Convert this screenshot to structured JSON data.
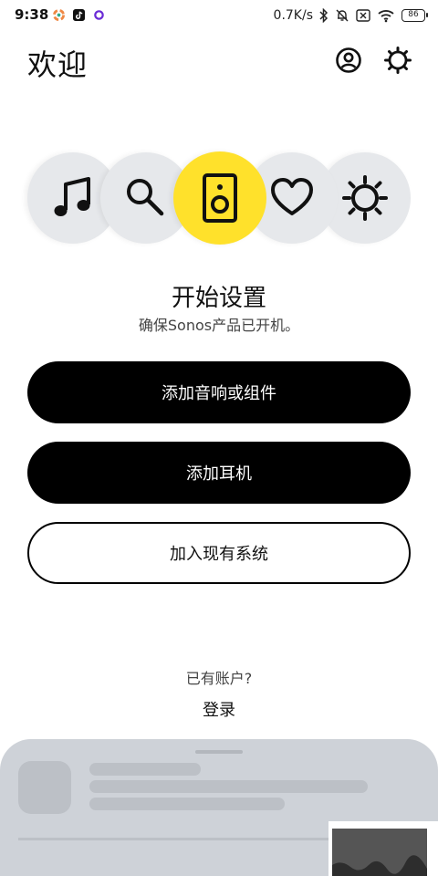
{
  "status_bar": {
    "time": "9:38",
    "net_speed": "0.7K/s",
    "battery": "86"
  },
  "header": {
    "title": "欢迎"
  },
  "hero": {
    "icons": [
      "music-note-icon",
      "search-icon",
      "speaker-icon",
      "heart-icon",
      "sun-icon"
    ],
    "active_index": 2,
    "active_color": "#ffe12b"
  },
  "setup": {
    "title": "开始设置",
    "subtitle": "确保Sonos产品已开机。"
  },
  "buttons": {
    "add_speaker": "添加音响或组件",
    "add_headphones": "添加耳机",
    "join_system": "加入现有系统"
  },
  "account": {
    "prompt": "已有账户?",
    "login": "登录"
  }
}
